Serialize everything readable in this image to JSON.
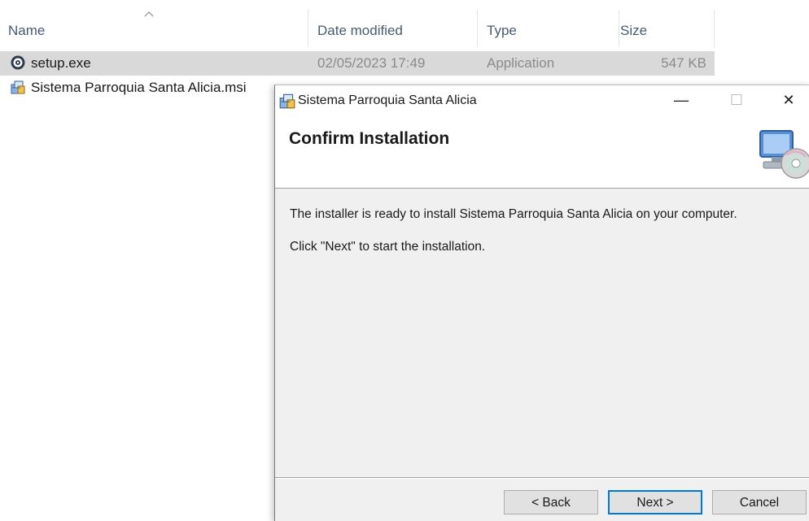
{
  "explorer": {
    "columns": [
      {
        "label": "Name"
      },
      {
        "label": "Date modified"
      },
      {
        "label": "Type"
      },
      {
        "label": "Size"
      }
    ],
    "sort_indicator": "chevron-up-icon",
    "files": [
      {
        "name": "setup.exe",
        "date": "02/05/2023 17:49",
        "type": "Application",
        "size": "547 KB",
        "icon": "setup-exe-icon",
        "selected": true
      },
      {
        "name": "Sistema Parroquia Santa Alicia.msi",
        "date": "",
        "type": "",
        "size": "",
        "icon": "msi-installer-icon",
        "selected": false
      }
    ]
  },
  "dialog": {
    "title": "Sistema Parroquia Santa Alicia",
    "minimize_glyph": "—",
    "maximize_glyph": "☐",
    "close_glyph": "✕",
    "heading": "Confirm Installation",
    "line1": "The installer is ready to install Sistema Parroquia Santa Alicia on your computer.",
    "line2": "Click \"Next\" to start the installation.",
    "buttons": {
      "back": "< Back",
      "next": "Next >",
      "cancel": "Cancel"
    }
  },
  "colors": {
    "selection": "#d9d9d9",
    "dialog_bg": "#f0f0f0",
    "default_button_border": "#0078d7"
  }
}
